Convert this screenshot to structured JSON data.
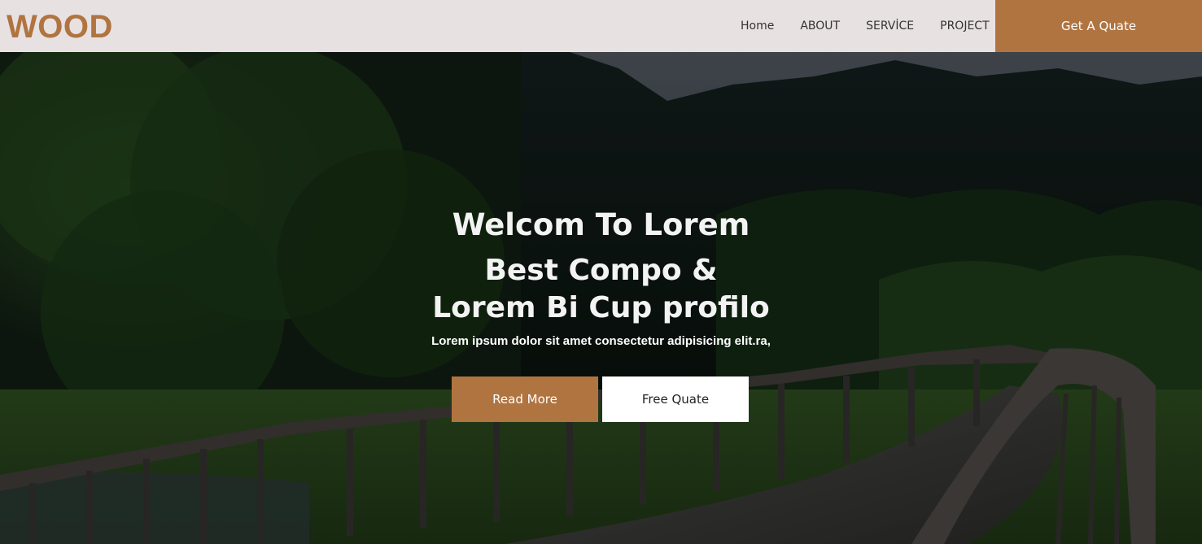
{
  "brand": {
    "logo_text": "WOOD",
    "accent_color": "#b07441"
  },
  "nav": {
    "items": [
      {
        "label": "Home"
      },
      {
        "label": "ABOUT"
      },
      {
        "label": "SERVİCE"
      },
      {
        "label": "PROJECT"
      }
    ],
    "cta_label": "Get A Quate"
  },
  "hero": {
    "title": "Welcom To Lorem",
    "subtitle_line1": "Best Compo &",
    "subtitle_line2": "Lorem Bi Cup profilo",
    "description": "Lorem ipsum dolor sit amet consectetur adipisicing elit.ra,",
    "primary_button": "Read More",
    "secondary_button": "Free Quate",
    "background_image": "forest-bridge-photo"
  }
}
